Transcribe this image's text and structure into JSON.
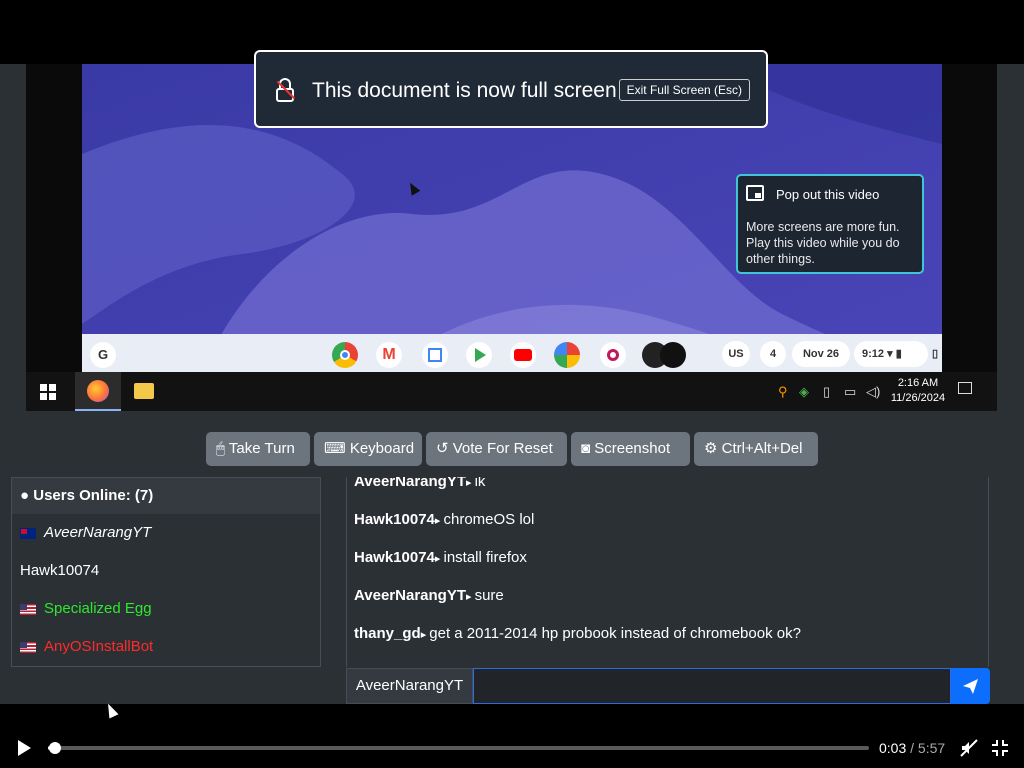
{
  "fullscreen_notice": {
    "message": "This document is now full screen",
    "exit_label": "Exit Full Screen (Esc)"
  },
  "popout": {
    "title": "Pop out this video",
    "body": "More screens are more fun. Play this video while you do other things."
  },
  "chromeos_shelf": {
    "launcher": "G",
    "apps": [
      "chrome-icon",
      "gmail-icon",
      "calendar-icon",
      "play-store-icon",
      "youtube-icon",
      "photos-icon",
      "screen-record-icon",
      "app-icon"
    ],
    "status": {
      "ime": "US",
      "notifications": "4",
      "date": "Nov 26",
      "time": "9:12"
    }
  },
  "windows_taskbar": {
    "time": "2:16 AM",
    "date": "11/26/2024"
  },
  "toolbar": {
    "take_turn": "Take Turn",
    "keyboard": "Keyboard",
    "vote_reset": "Vote For Reset",
    "screenshot": "Screenshot",
    "ctrl_alt_del": "Ctrl+Alt+Del"
  },
  "users": {
    "header": "Users Online: (7)",
    "list": [
      {
        "name": "AveerNarangYT",
        "flag": "AU",
        "color": "#ffffff",
        "italic": true
      },
      {
        "name": "Hawk10074",
        "flag": "",
        "color": "#ffffff",
        "italic": false
      },
      {
        "name": "Specialized Egg",
        "flag": "US",
        "color": "#2ee82e",
        "italic": false
      },
      {
        "name": "AnyOSInstallBot",
        "flag": "US",
        "color": "#ff2a2a",
        "italic": false
      }
    ]
  },
  "chat": {
    "messages": [
      {
        "user": "AveerNarangYT",
        "text": "ik"
      },
      {
        "user": "Hawk10074",
        "text": "chromeOS lol"
      },
      {
        "user": "Hawk10074",
        "text": "install firefox"
      },
      {
        "user": "AveerNarangYT",
        "text": "sure"
      },
      {
        "user": "thany_gd",
        "text": "get a 2011-2014 hp probook instead of chromebook ok?"
      }
    ],
    "username": "AveerNarangYT",
    "input_value": ""
  },
  "video": {
    "current_time": "0:03",
    "separator": "/",
    "duration": "5:57",
    "progress_fraction": 0.008
  },
  "colors": {
    "accent": "#0d6efd",
    "button": "#6c757d",
    "popout_border": "#3fc5d6"
  }
}
